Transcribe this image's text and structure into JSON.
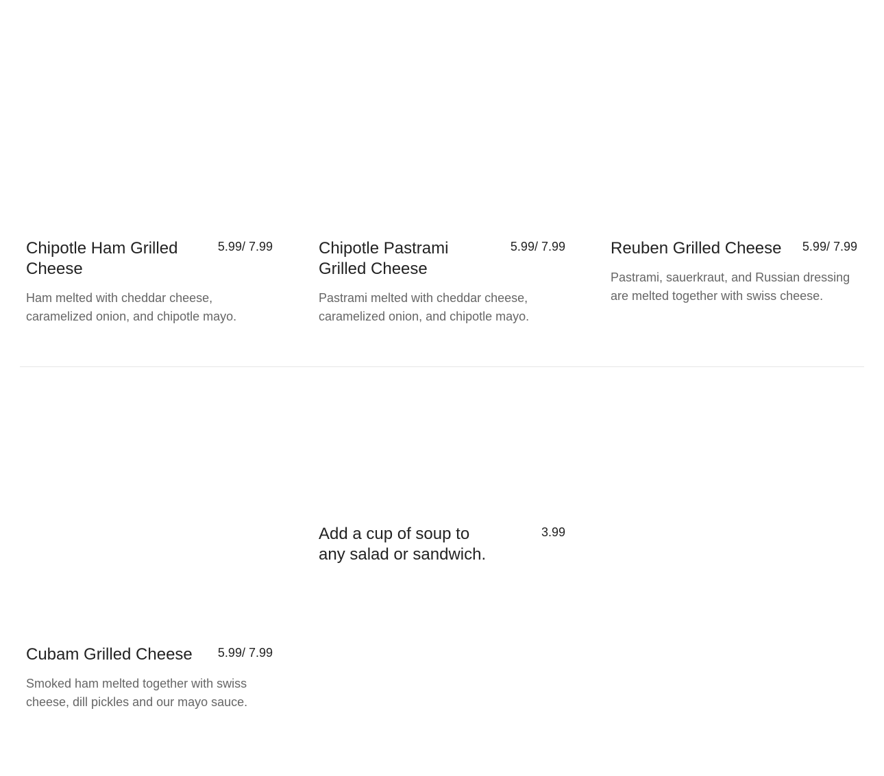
{
  "menu": {
    "items": [
      {
        "name": "Chipotle Ham Grilled Cheese",
        "price": "5.99/ 7.99",
        "description": "Ham melted with cheddar cheese, caramelized onion, and chipotle mayo."
      },
      {
        "name": "Chipotle Pastrami Grilled Cheese",
        "price": "5.99/ 7.99",
        "description": "Pastrami melted with cheddar cheese, caramelized onion, and chipotle mayo."
      },
      {
        "name": "Reuben Grilled Cheese",
        "price": "5.99/ 7.99",
        "description": "Pastrami, sauerkraut, and Russian dressing are melted together with swiss cheese."
      },
      {
        "name": "Add a cup of soup to any salad or sandwich.",
        "price": "3.99",
        "description": ""
      },
      {
        "name": "Cubam Grilled Cheese",
        "price": "5.99/ 7.99",
        "description": "Smoked ham melted together with swiss cheese, dill pickles and our mayo sauce."
      }
    ]
  },
  "colors": {
    "text": "#222222",
    "description": "#666666",
    "divider": "#e6e6e6"
  }
}
